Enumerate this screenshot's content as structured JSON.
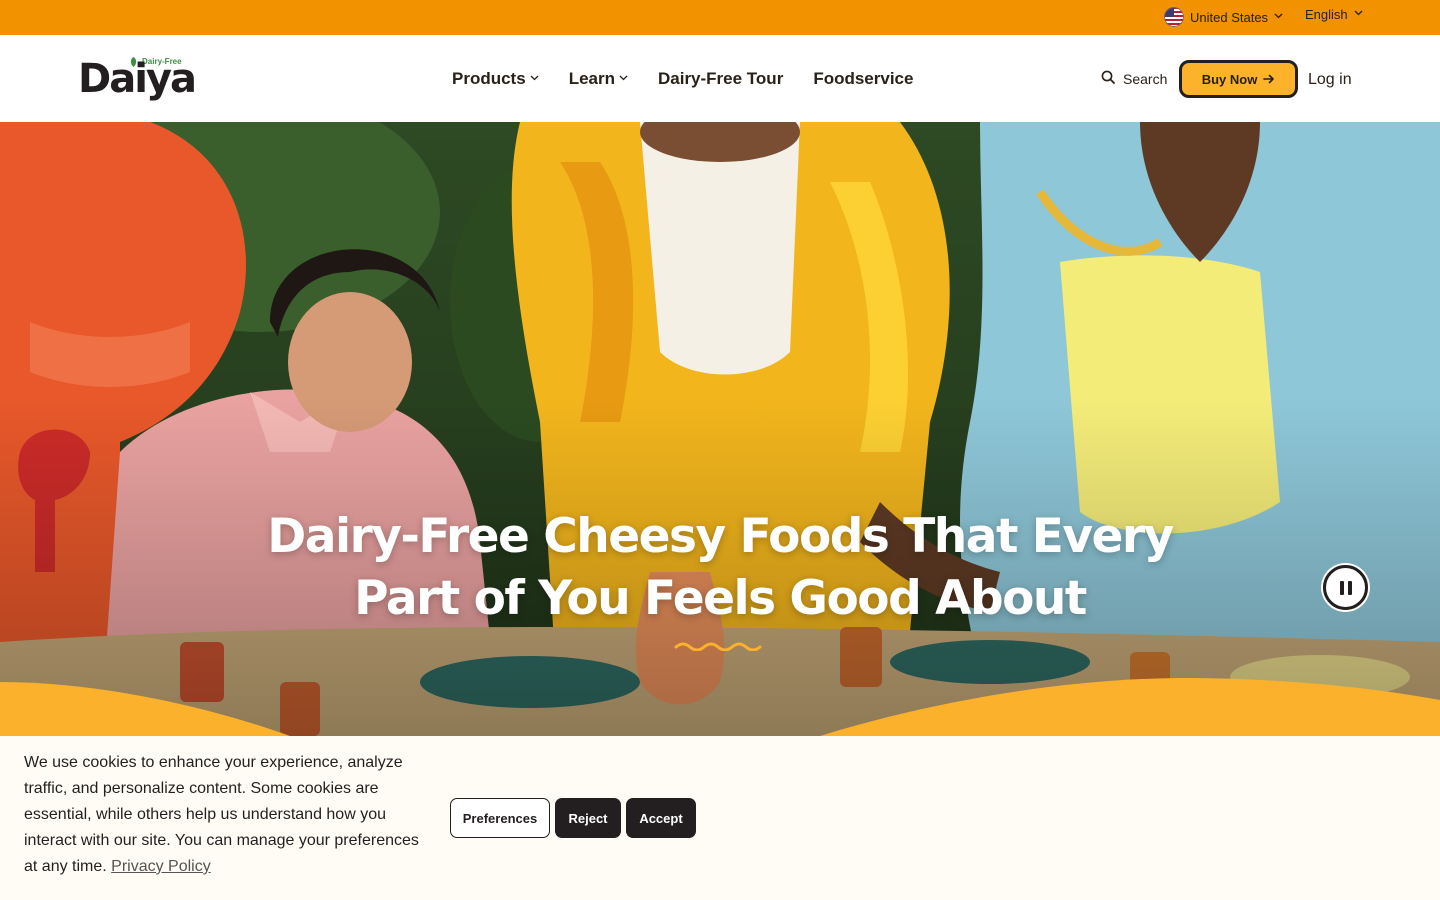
{
  "topbar": {
    "country": "United States",
    "language": "English",
    "background": "#f39200"
  },
  "header": {
    "logo": {
      "wordmark": "Daiya",
      "tagline": "Dairy-Free"
    },
    "nav": [
      {
        "label": "Products",
        "has_dropdown": true
      },
      {
        "label": "Learn",
        "has_dropdown": true
      },
      {
        "label": "Dairy-Free Tour",
        "has_dropdown": false
      },
      {
        "label": "Foodservice",
        "has_dropdown": false
      }
    ],
    "search_label": "Search",
    "buy_now_label": "Buy Now",
    "login_label": "Log in",
    "accent": "#fcb22a"
  },
  "hero": {
    "title_line1": "Dairy-Free Cheesy Foods That Every",
    "title_line2": "Part of You Feels Good About",
    "pause_icon": "pause-icon"
  },
  "cookie_banner": {
    "text": "We use cookies to enhance your experience, analyze traffic, and personalize content. Some cookies are essential, while others help us understand how you interact with our site. You can manage your preferences at any time.",
    "privacy_link": "Privacy Policy",
    "preferences_label": "Preferences",
    "reject_label": "Reject",
    "accept_label": "Accept"
  },
  "icons": {
    "country": "us-flag-icon",
    "dropdown": "chevron-down-icon",
    "search": "search-icon",
    "arrow": "arrow-right-icon"
  }
}
